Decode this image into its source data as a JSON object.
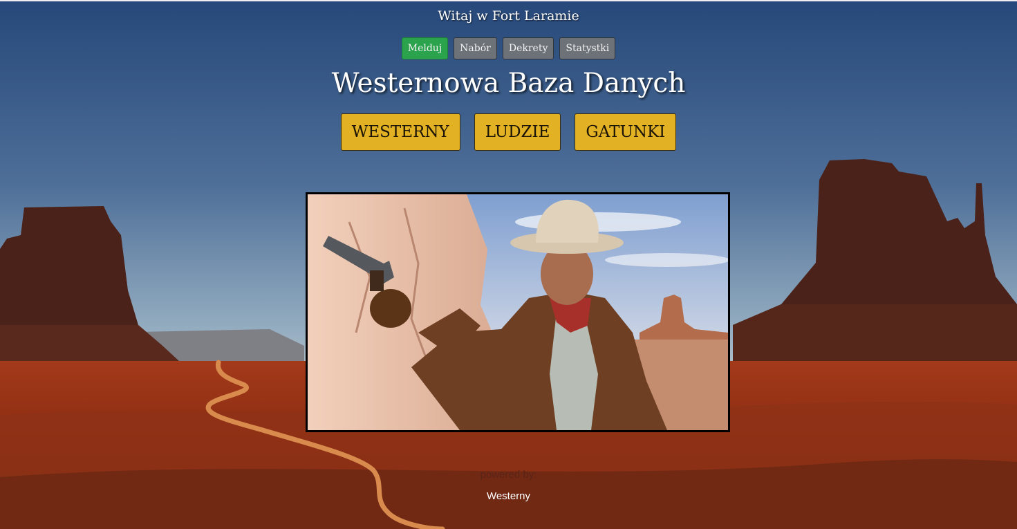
{
  "header": {
    "welcome": "Witaj w Fort Laramie",
    "nav": [
      {
        "label": "Melduj",
        "active": true
      },
      {
        "label": "Nabór",
        "active": false
      },
      {
        "label": "Dekrety",
        "active": false
      },
      {
        "label": "Statystki",
        "active": false
      }
    ]
  },
  "main": {
    "title": "Westernowa Baza Danych",
    "categories": [
      {
        "label": "WESTERNY"
      },
      {
        "label": "LUDZIE"
      },
      {
        "label": "GATUNKI"
      }
    ]
  },
  "footer": {
    "powered_by": "powered by:",
    "link": "Westerny"
  },
  "colors": {
    "sky_top": "#27497a",
    "sky_bottom": "#a5bcc8",
    "ground": "#8a2c14",
    "mesa": "#4a2218",
    "accent_button": "#e2b224",
    "active_button": "#2ba24c",
    "inactive_button": "#6d7278"
  }
}
